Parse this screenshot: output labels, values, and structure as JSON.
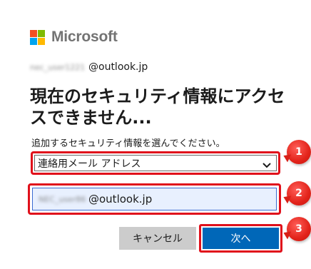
{
  "brand": {
    "name": "Microsoft",
    "logo_colors": [
      "#f25022",
      "#7fba00",
      "#00a4ef",
      "#ffb900"
    ]
  },
  "identity": {
    "hidden_user": "nec_user1221",
    "domain": "@outlook.jp"
  },
  "title": "現在のセキュリティ情報にアクセスできません...",
  "prompt": "追加するセキュリティ情報を選んでください。",
  "method_select": {
    "selected": "連絡用メール アドレス",
    "icon": "chevron-down-icon"
  },
  "email_field": {
    "hidden_user": "NEC_user86",
    "domain": "@outlook.jp"
  },
  "buttons": {
    "cancel": "キャンセル",
    "next": "次へ"
  },
  "callouts": [
    "1",
    "2",
    "3"
  ],
  "colors": {
    "highlight": "#e0101b",
    "primary_button": "#0067b8",
    "secondary_button": "#cccccc",
    "badge": "#e2231a"
  }
}
